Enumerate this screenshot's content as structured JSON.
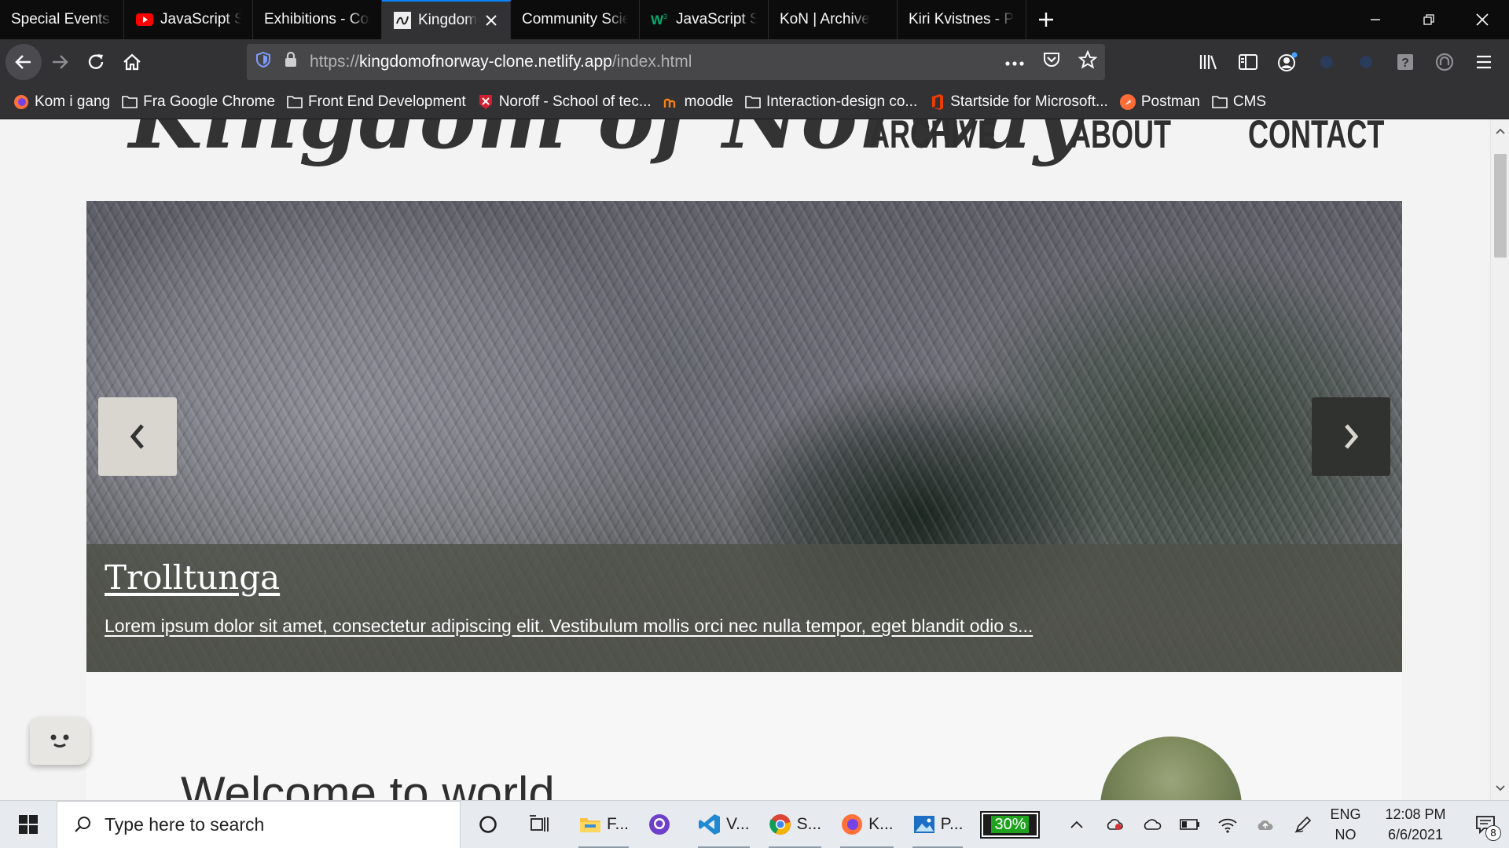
{
  "browser": {
    "tabs": [
      {
        "label": "Special Events and Ex",
        "icon": "none",
        "active": false
      },
      {
        "label": "JavaScript Search",
        "icon": "youtube-icon",
        "active": false
      },
      {
        "label": "Exhibitions - Commu",
        "icon": "none",
        "active": false
      },
      {
        "label": "Kingdom of N",
        "icon": "site-favicon",
        "active": true
      },
      {
        "label": "Community Science M",
        "icon": "none",
        "active": false
      },
      {
        "label": "JavaScript String",
        "icon": "w3schools-icon",
        "active": false
      },
      {
        "label": "KoN | Archive",
        "icon": "none",
        "active": false
      },
      {
        "label": "Kiri Kvistnes - Portfoli",
        "icon": "none",
        "active": false
      }
    ],
    "url": {
      "scheme": "https://",
      "host": "kingdomofnorway-clone.netlify.app",
      "path": "/index.html"
    },
    "bookmarks": [
      {
        "label": "Kom i gang",
        "icon": "firefox-icon"
      },
      {
        "label": "Fra Google Chrome",
        "icon": "folder-icon"
      },
      {
        "label": "Front End Development",
        "icon": "folder-icon"
      },
      {
        "label": "Noroff - School of tec...",
        "icon": "noroff-icon"
      },
      {
        "label": "moodle",
        "icon": "moodle-icon"
      },
      {
        "label": "Interaction-design co...",
        "icon": "folder-icon"
      },
      {
        "label": "Startside for Microsoft...",
        "icon": "office-icon"
      },
      {
        "label": "Postman",
        "icon": "postman-icon"
      },
      {
        "label": "CMS",
        "icon": "folder-icon"
      }
    ]
  },
  "site": {
    "logo": "Kingdom of Norway",
    "nav": [
      "ARCHIVE",
      "ABOUT",
      "CONTACT"
    ],
    "carousel": {
      "title": "Trolltunga",
      "text": "Lorem ipsum dolor sit amet, consectetur adipiscing elit. Vestibulum mollis orci nec nulla tempor, eget blandit odio s...",
      "prev_glyph": "‹",
      "next_glyph": "›"
    },
    "welcome_heading": "Welcome to world...",
    "accent": "#333333"
  },
  "taskbar": {
    "search_placeholder": "Type here to search",
    "apps": [
      {
        "label": "F...",
        "icon": "file-explorer-icon"
      },
      {
        "label": "",
        "icon": "github-desktop-icon"
      },
      {
        "label": "V...",
        "icon": "vscode-icon"
      },
      {
        "label": "S...",
        "icon": "chrome-icon"
      },
      {
        "label": "K...",
        "icon": "firefox-icon"
      },
      {
        "label": "P...",
        "icon": "photos-icon"
      }
    ],
    "battery_percent": "30%",
    "lang_top": "ENG",
    "lang_bottom": "NO",
    "time": "12:08 PM",
    "date": "6/6/2021",
    "notification_count": "8"
  }
}
